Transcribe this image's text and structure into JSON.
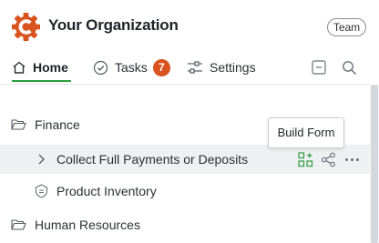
{
  "header": {
    "org_name": "Your Organization",
    "team_badge": "Team",
    "brand_color": "#d9531e"
  },
  "nav": {
    "home_label": "Home",
    "tasks_label": "Tasks",
    "tasks_count": "7",
    "settings_label": "Settings",
    "active_tab": "Home",
    "active_color": "#2f9e3f"
  },
  "tree": {
    "items": [
      {
        "label": "Finance",
        "icon": "folder-open-icon"
      },
      {
        "label": "Collect Full Payments or Deposits",
        "icon": "chevron-right-icon",
        "highlighted": true
      },
      {
        "label": "Product Inventory",
        "icon": "shield-icon"
      },
      {
        "label": "Human Resources",
        "icon": "folder-open-icon"
      }
    ]
  },
  "tooltip": {
    "text": "Build Form"
  }
}
